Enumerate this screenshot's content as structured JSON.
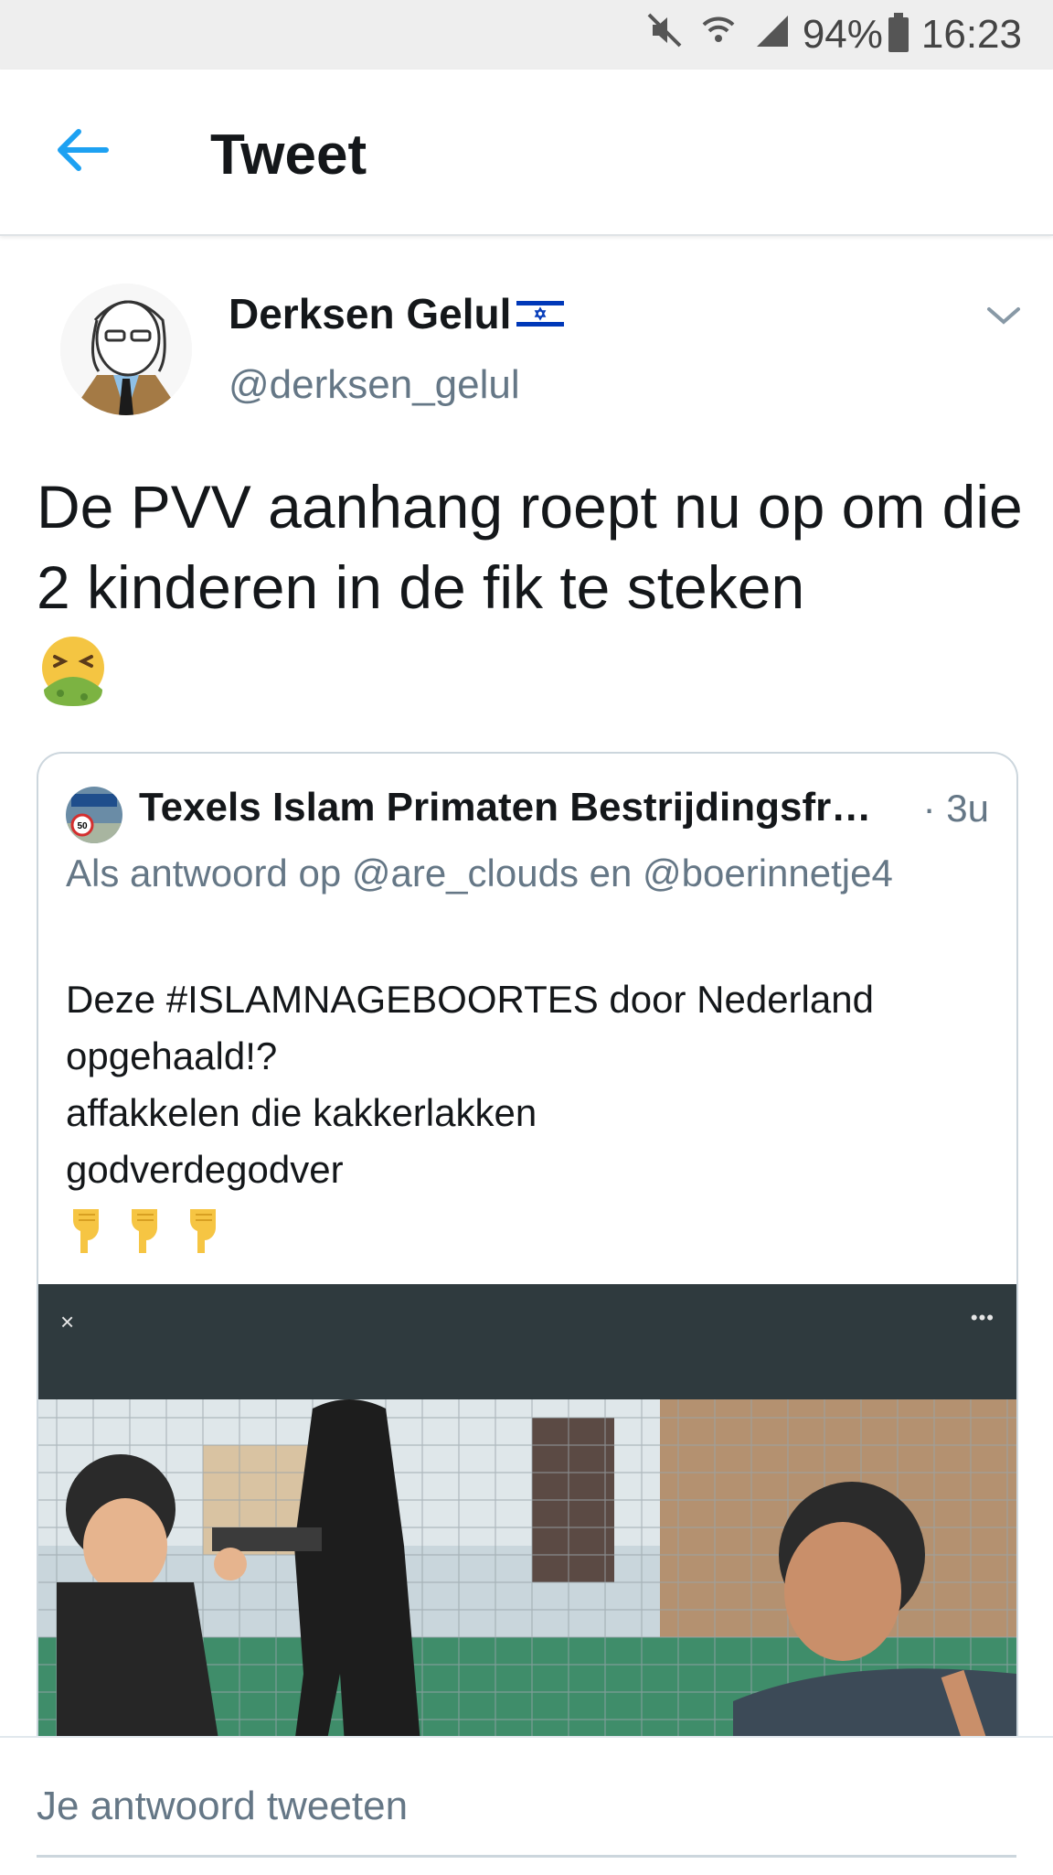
{
  "status_bar": {
    "icons": [
      "mute-icon",
      "wifi-icon",
      "signal-icon",
      "battery-icon"
    ],
    "battery": "94%",
    "time": "16:23"
  },
  "header": {
    "back_icon": "arrow-left-icon",
    "title": "Tweet"
  },
  "tweet": {
    "author_name": "Derksen Gelul",
    "author_flag": "israel-flag-icon",
    "author_handle": "@derksen_gelul",
    "text": "De PVV aanhang roept nu op om die 2 kinderen in de fik te steken",
    "emoji": "nauseated-face-icon",
    "menu_icon": "chevron-down-icon"
  },
  "quoted_tweet": {
    "author_name": "Texels Islam Primaten Bestrijdingsfr…",
    "time": "· 3u",
    "reply_context": "Als antwoord op @are_clouds en @boerinnetje4",
    "text": "Deze #ISLAMNAGEBOORTES door Nederland opgehaald!?\naffakkelen die kakkerlakken\n godverdegodver",
    "emojis": [
      "pointing-down-icon",
      "pointing-down-icon",
      "pointing-down-icon"
    ],
    "media": {
      "close_label": "×",
      "more_label": "•••"
    }
  },
  "reply": {
    "placeholder": "Je antwoord tweeten"
  },
  "colors": {
    "accent": "#1da1f2",
    "secondary_text": "#657786",
    "border": "#ccd6dd"
  }
}
